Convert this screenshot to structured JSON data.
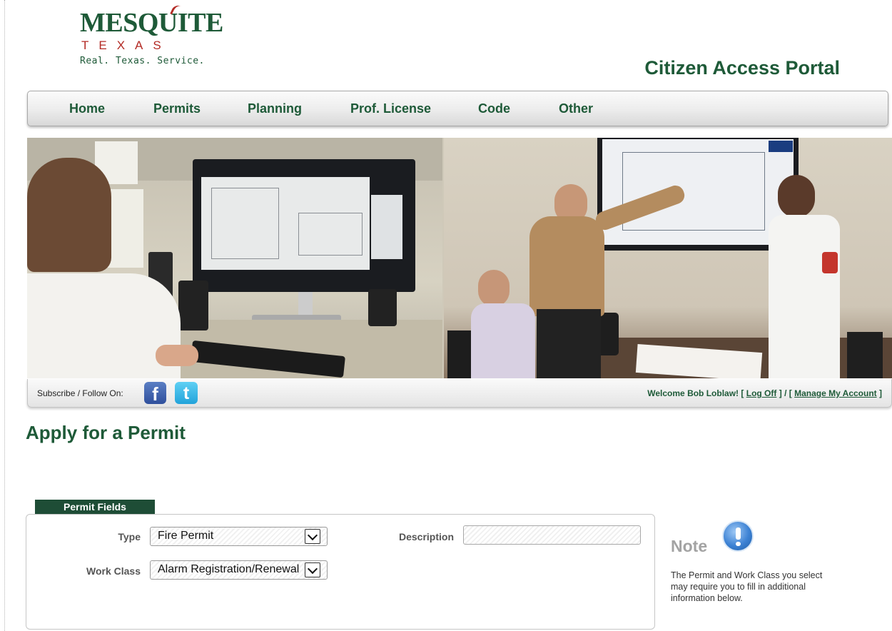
{
  "header": {
    "logo_word": "MESQUITE",
    "logo_state": "TEXAS",
    "logo_tagline": "Real. Texas. Service.",
    "portal_title": "Citizen Access Portal"
  },
  "nav": {
    "items": [
      "Home",
      "Permits",
      "Planning",
      "Prof. License",
      "Code",
      "Other"
    ]
  },
  "social": {
    "follow_label": "Subscribe / Follow On:",
    "facebook_glyph": "f",
    "twitter_glyph": "t"
  },
  "account": {
    "welcome_text": "Welcome Bob Loblaw! [",
    "logoff_label": "Log Off",
    "separator": "] / [",
    "manage_label": "Manage My Account",
    "close_bracket": "]"
  },
  "page": {
    "title": "Apply for a Permit"
  },
  "permit_fields": {
    "tab_label": "Permit Fields",
    "type_label": "Type",
    "type_value": "Fire Permit",
    "work_class_label": "Work Class",
    "work_class_value": "Alarm Registration/Renewal",
    "description_label": "Description",
    "description_value": ""
  },
  "note": {
    "title": "Note",
    "text": "The Permit and Work Class you select may require you to fill in additional information below."
  },
  "colors": {
    "brand_green": "#1e5a38",
    "tab_green": "#1e4d36",
    "logo_red": "#b32a24",
    "note_gray": "#a3a3a3"
  },
  "icons": [
    "facebook-icon",
    "twitter-icon",
    "info-icon",
    "chevron-down-icon"
  ]
}
